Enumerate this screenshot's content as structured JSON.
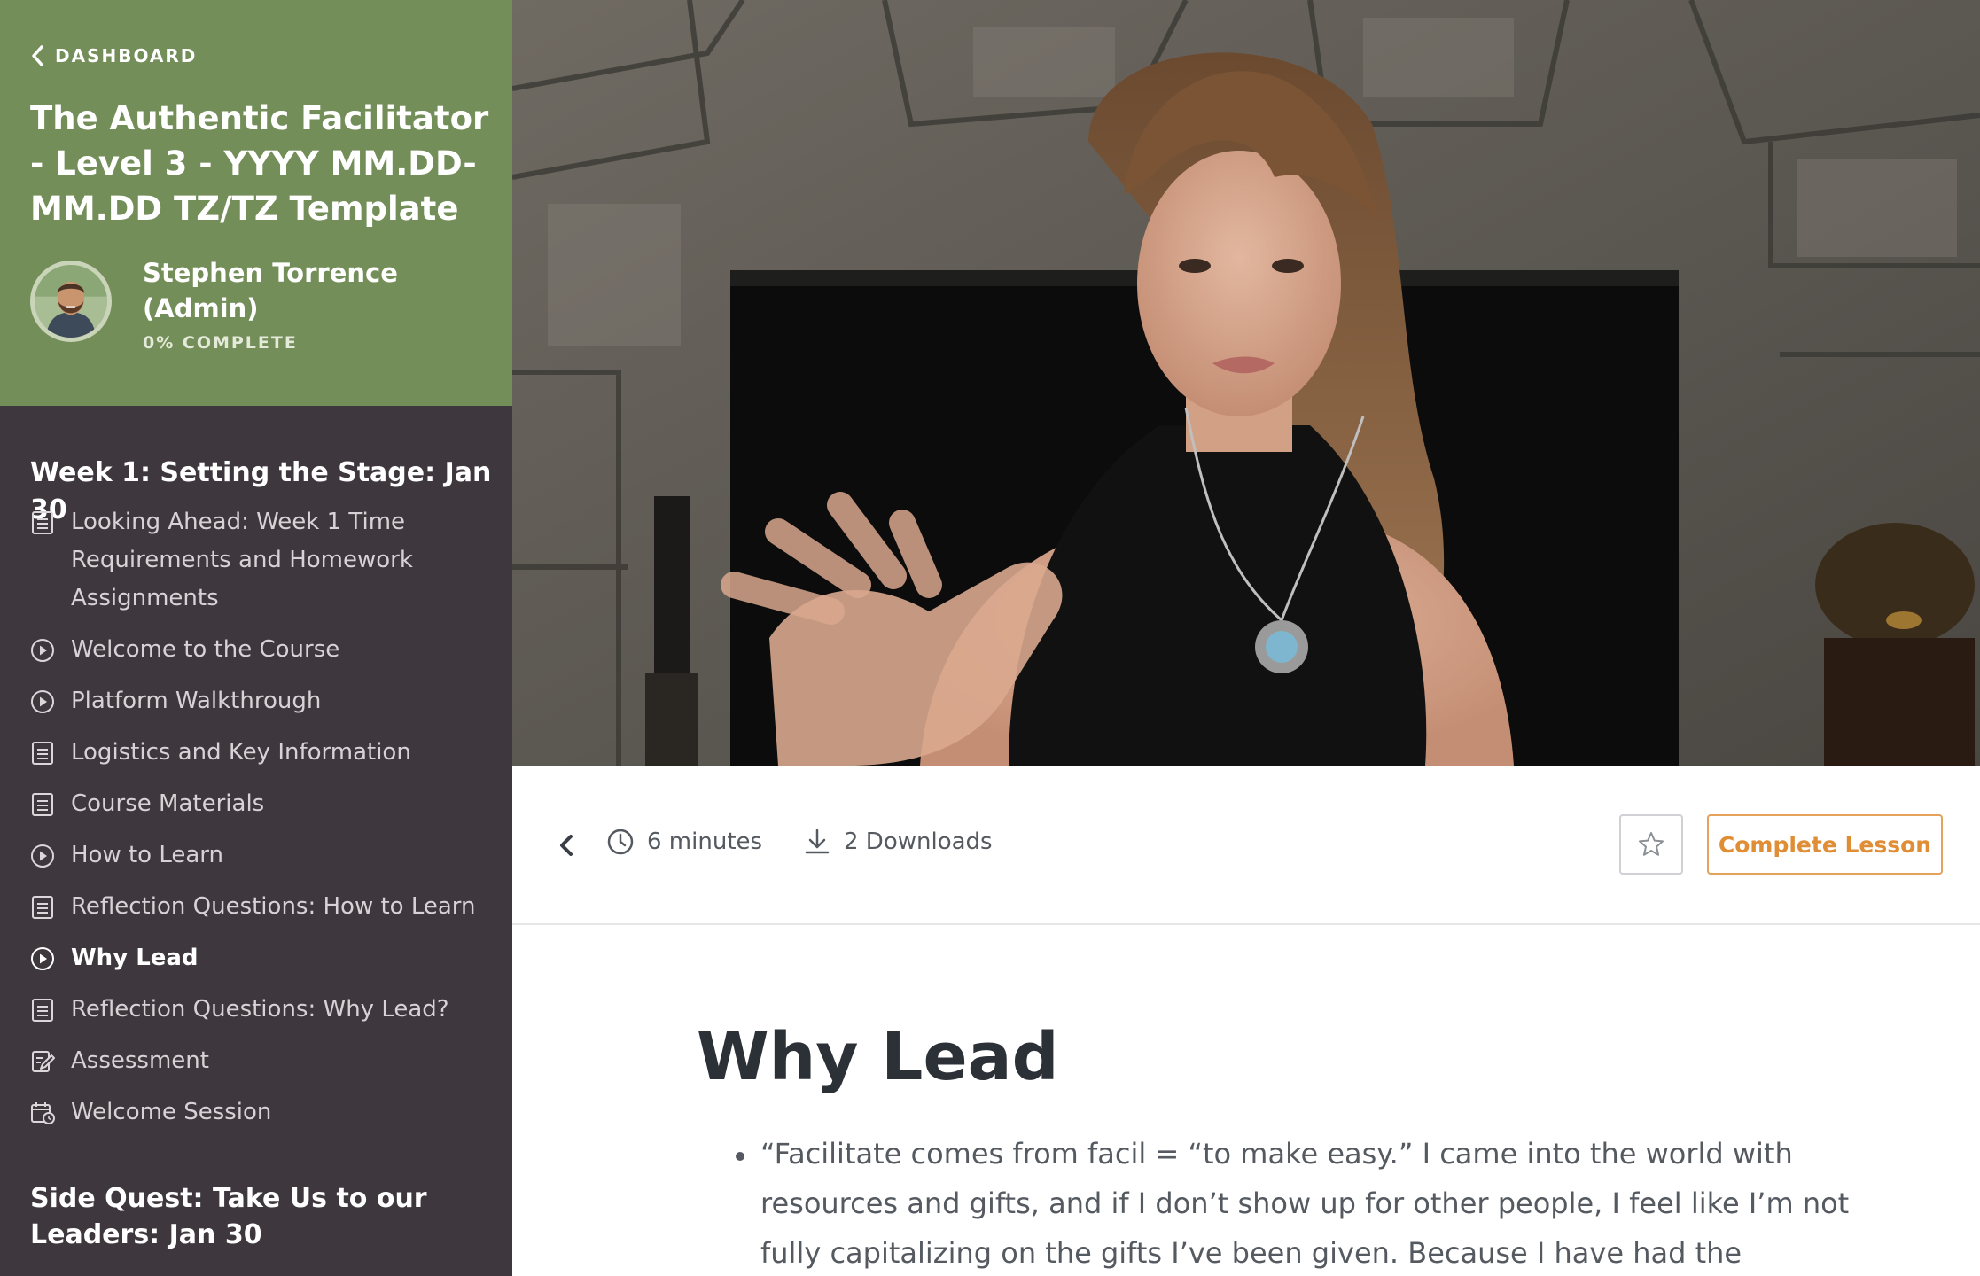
{
  "sidebar": {
    "back_label": "DASHBOARD",
    "course_title": "The Authentic Facilitator - Level 3 - YYYY MM.DD-MM.DD TZ/TZ Template",
    "user_name": "Stephen Torrence (Admin)",
    "progress_label": "0% COMPLETE",
    "header_color": "#738e58",
    "section_title": "Week 1: Setting the Stage: Jan 30",
    "lessons": [
      {
        "label": "Looking Ahead: Week 1 Time Requirements and Homework Assignments",
        "icon": "text-lesson-icon"
      },
      {
        "label": "Welcome to the Course",
        "icon": "play-circle-icon"
      },
      {
        "label": "Platform Walkthrough",
        "icon": "play-circle-icon"
      },
      {
        "label": "Logistics and Key Information",
        "icon": "text-lesson-icon"
      },
      {
        "label": "Course Materials",
        "icon": "text-lesson-icon"
      },
      {
        "label": "How to Learn",
        "icon": "play-circle-icon"
      },
      {
        "label": "Reflection Questions: How to Learn",
        "icon": "text-lesson-icon"
      },
      {
        "label": "Why Lead",
        "icon": "play-circle-icon",
        "active": true
      },
      {
        "label": "Reflection Questions: Why Lead?",
        "icon": "text-lesson-icon"
      },
      {
        "label": "Assessment",
        "icon": "quiz-icon"
      },
      {
        "label": "Welcome Session",
        "icon": "calendar-icon"
      }
    ],
    "next_section_title": "Side Quest: Take Us to our Leaders: Jan 30"
  },
  "toolbar": {
    "duration": "6 minutes",
    "downloads": "2 Downloads",
    "complete_label": "Complete Lesson",
    "accent_color": "#e08e36"
  },
  "content": {
    "title": "Why Lead",
    "body": "“Facilitate comes from facil = “to make easy.” I came into the world with resources and gifts, and if I don’t show up for other people, I feel like I’m not fully capitalizing on the gifts I’ve been given. Because I have had the privilege to take"
  }
}
